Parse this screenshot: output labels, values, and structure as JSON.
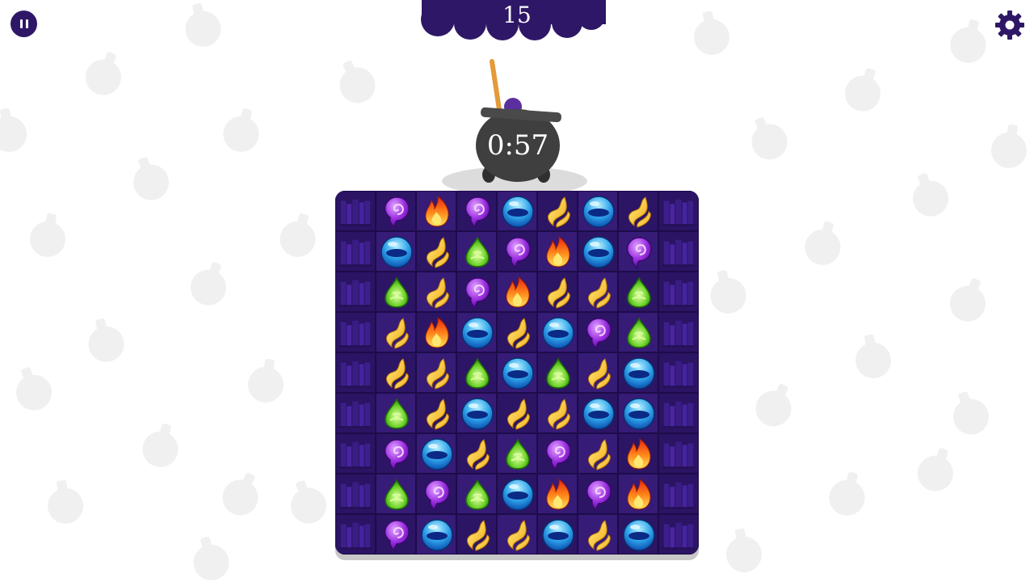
{
  "hud": {
    "score": "15",
    "timer": "0:57"
  },
  "icons": {
    "pause": "pause-icon",
    "settings": "gear-icon",
    "cauldron": "cauldron-icon"
  },
  "colors": {
    "hud_purple": "#2e1766",
    "board_bg": "#2a1463",
    "cell_dark": "#2c1565",
    "cell_light": "#361b77",
    "cauldron": "#3f3f3f"
  },
  "board": {
    "gem_types": [
      "purple-swirl",
      "fire",
      "blue-orb",
      "yellow-wave",
      "green-drop"
    ],
    "grid": [
      [
        "purple",
        "fire",
        "purple",
        "blue",
        "yellow",
        "blue",
        "yellow"
      ],
      [
        "blue",
        "yellow",
        "green",
        "purple",
        "fire",
        "blue",
        "purple"
      ],
      [
        "green",
        "yellow",
        "purple",
        "fire",
        "yellow",
        "yellow",
        "green"
      ],
      [
        "yellow",
        "fire",
        "blue",
        "yellow",
        "blue",
        "purple",
        "green"
      ],
      [
        "yellow",
        "yellow",
        "green",
        "blue",
        "green",
        "yellow",
        "blue"
      ],
      [
        "green",
        "yellow",
        "blue",
        "yellow",
        "yellow",
        "blue",
        "blue"
      ],
      [
        "purple",
        "blue",
        "yellow",
        "green",
        "purple",
        "yellow",
        "fire"
      ],
      [
        "green",
        "purple",
        "green",
        "blue",
        "fire",
        "purple",
        "fire"
      ],
      [
        "purple",
        "blue",
        "yellow",
        "yellow",
        "blue",
        "yellow",
        "blue"
      ]
    ]
  }
}
